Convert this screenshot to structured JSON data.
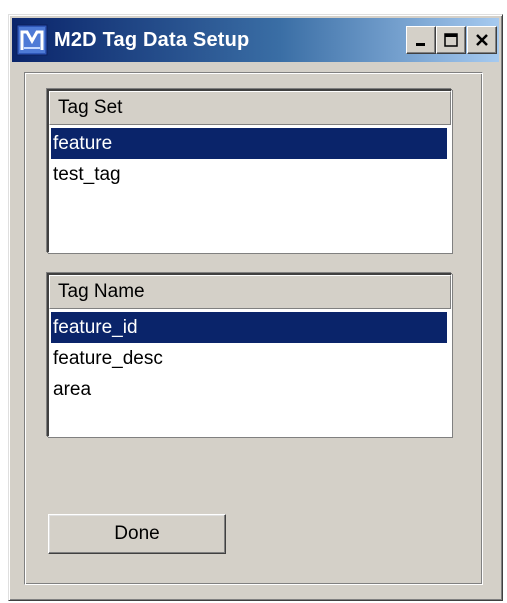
{
  "window": {
    "title": "M2D Tag Data Setup",
    "icon": "m2d-app-icon",
    "controls": {
      "minimize_icon": "minimize-icon",
      "maximize_icon": "maximize-icon",
      "close_icon": "close-icon"
    }
  },
  "tag_set": {
    "header": "Tag Set",
    "items": [
      {
        "label": "feature",
        "selected": true
      },
      {
        "label": "test_tag",
        "selected": false
      }
    ]
  },
  "tag_name": {
    "header": "Tag Name",
    "items": [
      {
        "label": "feature_id",
        "selected": true
      },
      {
        "label": "feature_desc",
        "selected": false
      },
      {
        "label": "area",
        "selected": false
      }
    ]
  },
  "buttons": {
    "done_label": "Done"
  },
  "colors": {
    "selection": "#0a246a",
    "face": "#d4d0c8",
    "titlebar_start": "#0a246a",
    "titlebar_end": "#a6caf0"
  }
}
